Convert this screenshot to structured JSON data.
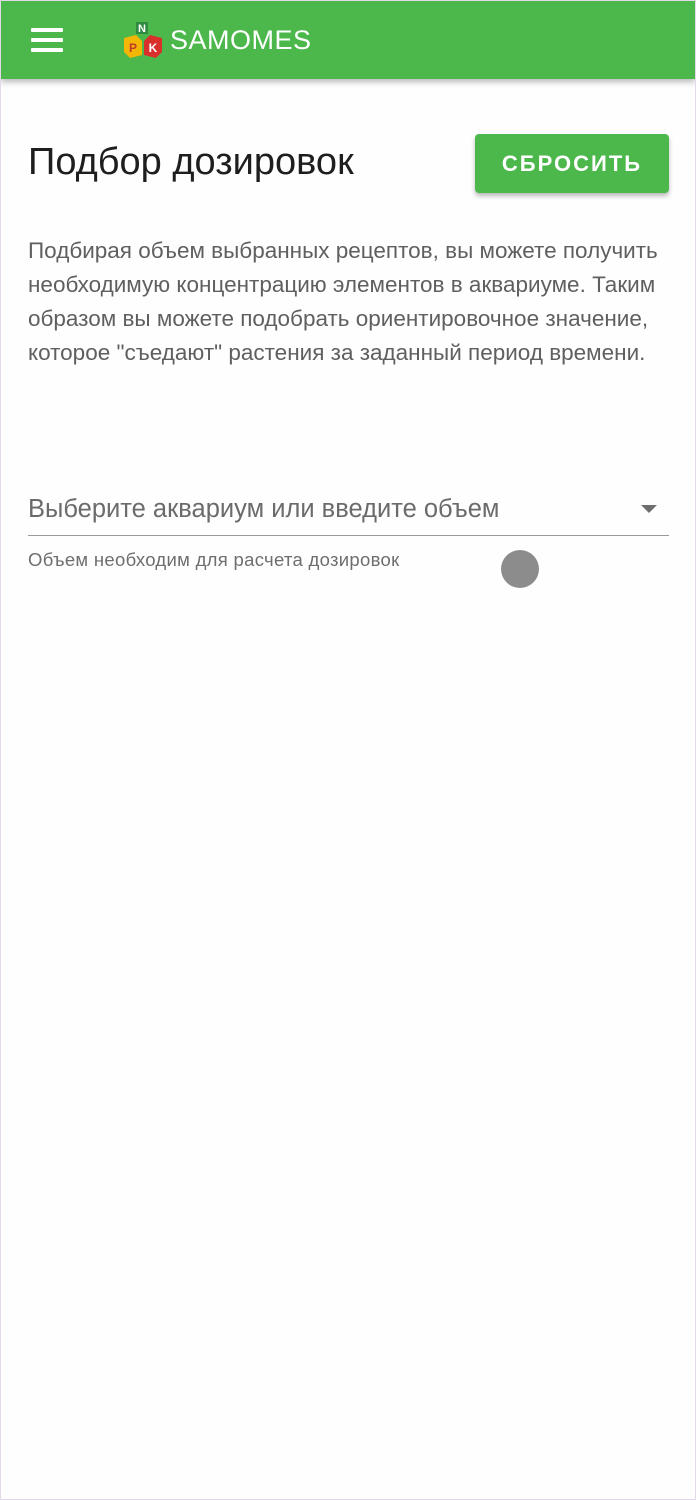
{
  "app_bar": {
    "title": "SAMOMES",
    "logo_letters": [
      "N",
      "P",
      "K"
    ],
    "background_color": "#4cb84c",
    "menu_icon": "hamburger-menu-icon"
  },
  "page": {
    "title": "Подбор дозировок",
    "reset_label": "СБРОСИТЬ",
    "description": "Подбирая объем выбранных рецептов, вы можете получить необходимую концентрацию элементов в аквариуме. Таким образом вы можете подобрать ориентировочное значение, которое \"съедают\" растения за заданный период времени."
  },
  "aquarium_select": {
    "placeholder": "Выберите аквариум или введите объем",
    "helper": "Объем необходим для расчета дозировок",
    "caret_icon": "dropdown-arrow-icon"
  }
}
